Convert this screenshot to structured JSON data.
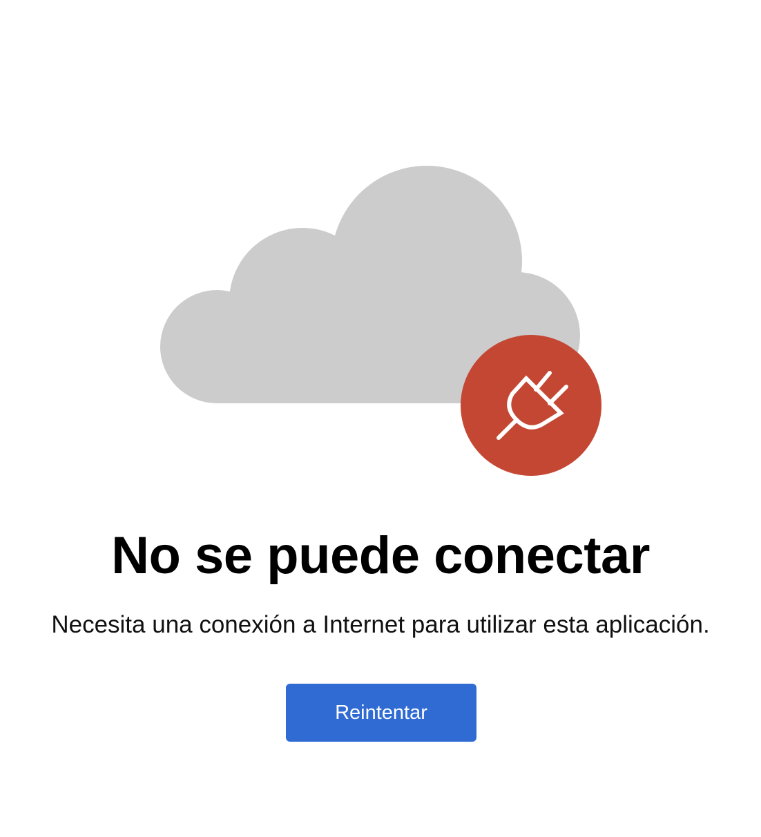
{
  "illustration": {
    "cloud_icon": "cloud-icon",
    "badge_icon": "unplugged-plug-icon",
    "cloud_color": "#cccccc",
    "badge_color": "#c44733"
  },
  "error": {
    "title": "No se puede conectar",
    "message": "Necesita una conexión a Internet para utilizar esta aplicación."
  },
  "actions": {
    "retry_label": "Reintentar",
    "retry_color": "#2f6bd3"
  }
}
